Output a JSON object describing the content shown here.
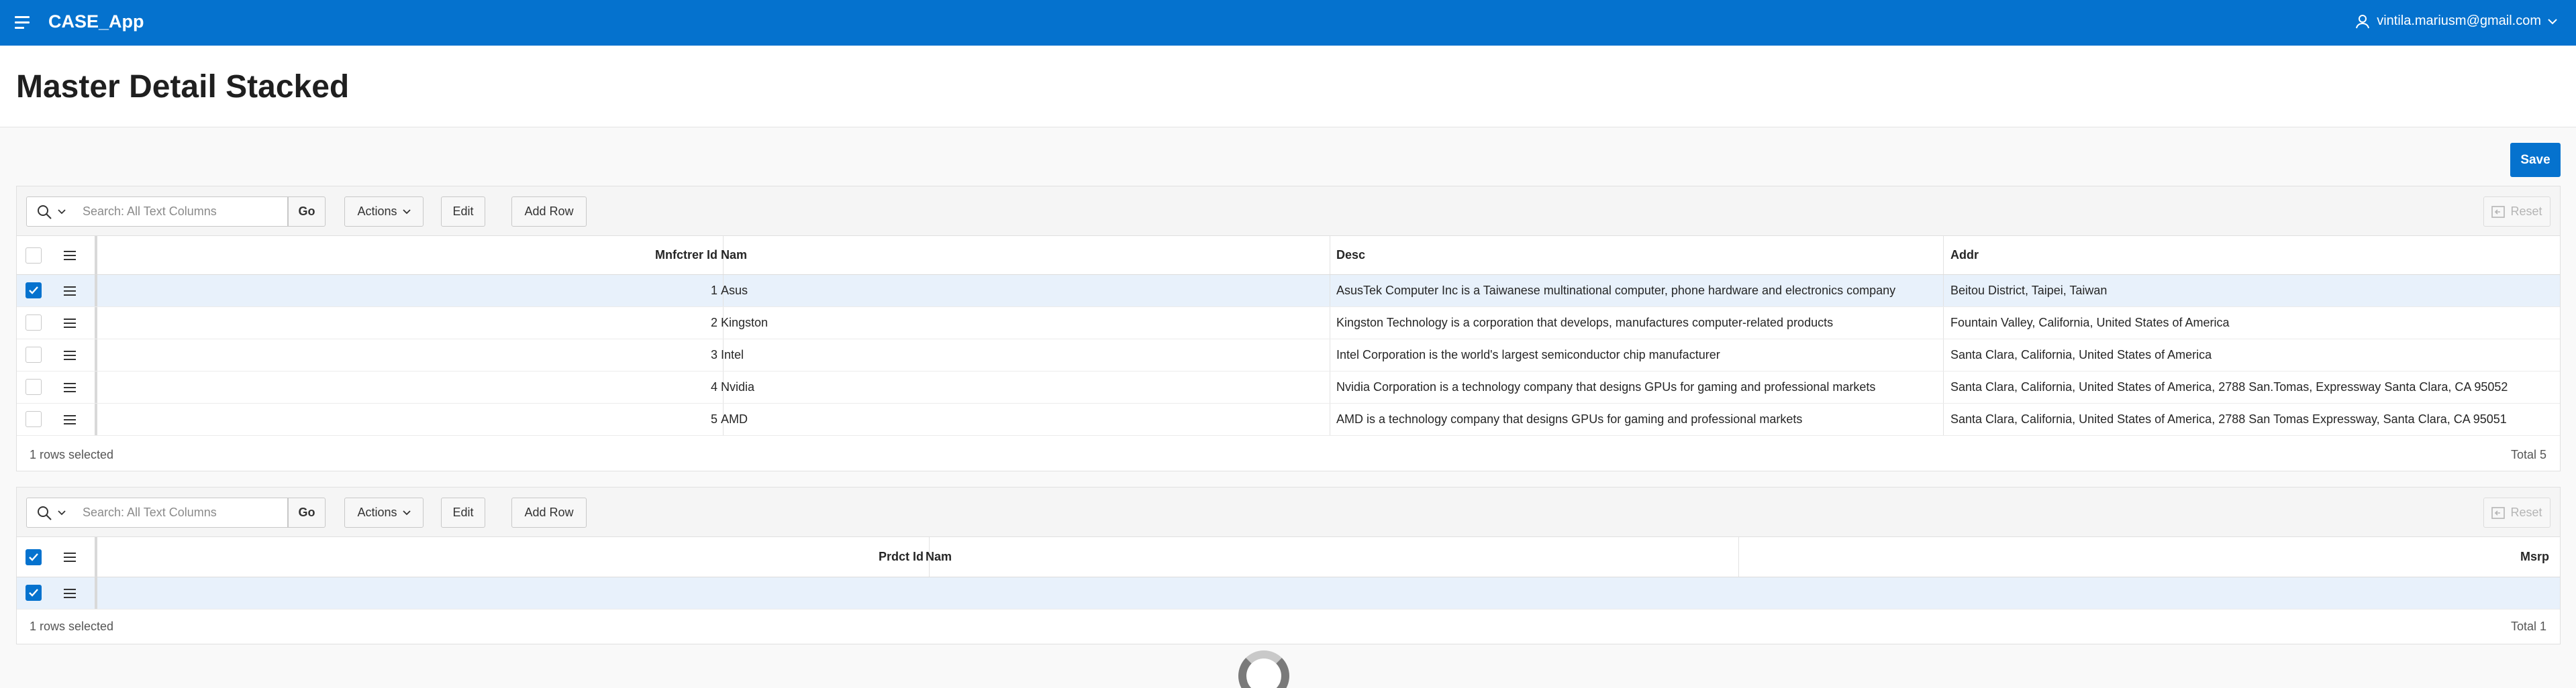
{
  "app": {
    "title": "CASE_App",
    "user": "vintila.mariusm@gmail.com"
  },
  "page": {
    "title": "Master Detail Stacked",
    "save_label": "Save"
  },
  "master": {
    "toolbar": {
      "search_placeholder": "Search: All Text Columns",
      "go": "Go",
      "actions": "Actions",
      "edit": "Edit",
      "add_row": "Add Row",
      "reset": "Reset"
    },
    "columns": [
      "Mnfctrer Id",
      "Nam",
      "Desc",
      "Addr"
    ],
    "rows": [
      {
        "id": "1",
        "nam": "Asus",
        "desc": "AsusTek Computer Inc is a Taiwanese multinational computer, phone hardware and electronics company",
        "addr": "Beitou District, Taipei, Taiwan",
        "selected": true
      },
      {
        "id": "2",
        "nam": "Kingston",
        "desc": "Kingston Technology is a corporation that develops, manufactures computer-related products",
        "addr": "Fountain Valley, California, United States of America",
        "selected": false
      },
      {
        "id": "3",
        "nam": "Intel",
        "desc": "Intel Corporation is the world's largest semiconductor chip manufacturer",
        "addr": "Santa Clara, California, United States of America",
        "selected": false
      },
      {
        "id": "4",
        "nam": "Nvidia",
        "desc": "Nvidia Corporation is a technology company that designs GPUs for gaming and professional markets",
        "addr": "Santa Clara, California, United States of America, 2788 San.Tomas, Expressway Santa Clara, CA 95052",
        "selected": false
      },
      {
        "id": "5",
        "nam": "AMD",
        "desc": "AMD is a technology company that designs GPUs for gaming and professional markets",
        "addr": "Santa Clara, California, United States of America, 2788 San Tomas Expressway, Santa Clara, CA 95051",
        "selected": false
      }
    ],
    "footer": {
      "selected": "1 rows selected",
      "total": "Total 5"
    }
  },
  "detail": {
    "toolbar": {
      "search_placeholder": "Search: All Text Columns",
      "go": "Go",
      "actions": "Actions",
      "edit": "Edit",
      "add_row": "Add Row",
      "reset": "Reset"
    },
    "columns": [
      "Prdct Id",
      "Nam",
      "Msrp"
    ],
    "footer": {
      "selected": "1 rows selected",
      "total": "Total 1"
    }
  },
  "colors": {
    "accent": "#0572ce",
    "selected_row": "#e8f1fb"
  },
  "icons": [
    "menu-icon",
    "user-icon",
    "chevron-down-icon",
    "search-icon",
    "reset-icon",
    "row-actions-icon",
    "loading-spinner"
  ]
}
